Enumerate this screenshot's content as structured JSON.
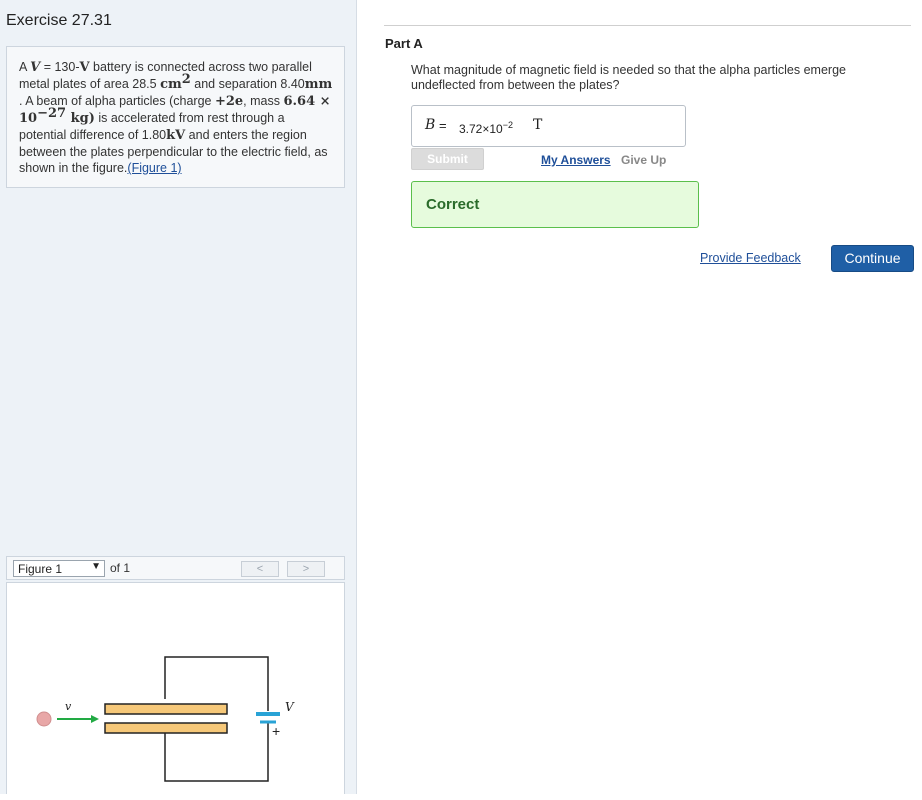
{
  "exercise": {
    "title": "Exercise 27.31"
  },
  "problem": {
    "t1": "A ",
    "V": "V",
    "t2": " = 130-",
    "Vunit": "V",
    "t3": " battery is connected across two parallel metal plates of area 28.5 ",
    "area_unit": "cm",
    "area_exp": "2",
    "t4": " and separation 8.40",
    "sep_unit": "mm",
    "t5": " . A beam of alpha particles (charge ",
    "charge": "+2e",
    "t6": ", mass ",
    "mass": "6.64 × 10",
    "mass_exp": "−27",
    "mass_unit": " kg)",
    "t7": " is accelerated from rest through a potential difference of 1.80",
    "pd_unit": "kV",
    "t8": " and enters the region between the plates perpendicular to the electric field, as shown in the figure.",
    "figure_link": "(Figure 1)"
  },
  "figure_nav": {
    "selected": "Figure 1",
    "of": "of 1",
    "prev": "<",
    "next": ">"
  },
  "figure": {
    "v_label": "v",
    "V_label": "V",
    "plus": "+"
  },
  "partA": {
    "title": "Part A",
    "question": "What magnitude of magnetic field is needed so that the alpha particles emerge undeflected from between the plates?",
    "var": "B",
    "eq": "=",
    "value_base": "3.72×10",
    "value_exp": "−2",
    "unit": "T",
    "submit": "Submit",
    "my_answers": "My Answers",
    "give_up": "Give Up",
    "correct": "Correct"
  },
  "footer": {
    "feedback": "Provide Feedback",
    "continue": "Continue"
  },
  "colors": {
    "left_bg": "#edf2f7",
    "link": "#1f4f99",
    "correct_bg": "#e6fbdd",
    "correct_border": "#5bbf4c",
    "continue_bg": "#1f5fa6",
    "plate_fill": "#f6c879",
    "arrow": "#22aa44",
    "particle": "#e8a7a7",
    "battery": "#29a3d6"
  }
}
